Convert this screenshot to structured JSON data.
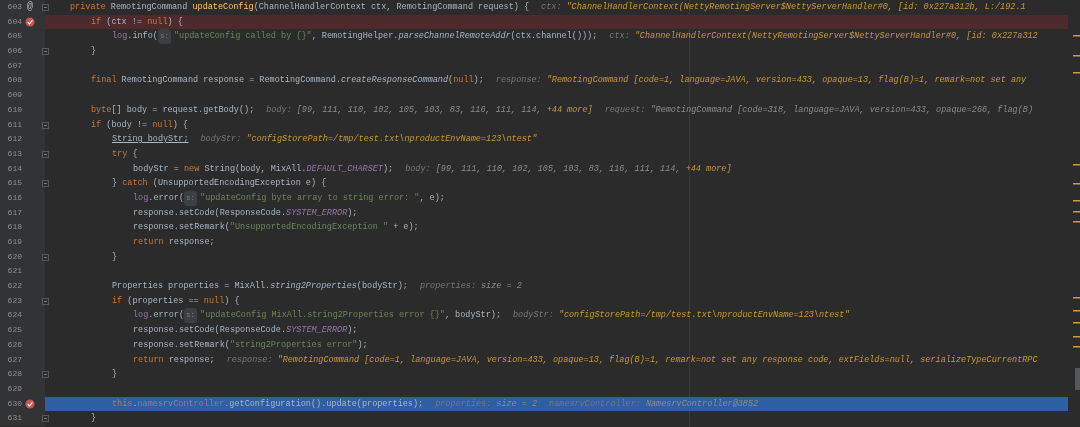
{
  "lines": [
    {
      "number": "603",
      "gutter_mark": "@",
      "breakpoint": false,
      "current": false,
      "fold": true,
      "tokens": [
        {
          "kind": "keyword",
          "text": "private "
        },
        {
          "kind": "plain",
          "text": "RemotingCommand "
        },
        {
          "kind": "method",
          "text": "updateConfig"
        },
        {
          "kind": "plain",
          "text": "(ChannelHandlerContext ctx, RemotingCommand request) {"
        },
        {
          "kind": "hint-name",
          "text": "ctx:"
        },
        {
          "kind": "hint-string",
          "text": "\"ChannelHandlerContext(NettyRemotingServer$NettyServerHandler#0, [id: 0x227a312b, L:/192.1"
        }
      ],
      "children": [
        {
          "number": "604",
          "breakpoint": true,
          "current": false,
          "fold": false,
          "tokens": [
            {
              "kind": "keyword",
              "text": "if"
            },
            {
              "kind": "plain",
              "text": " (ctx != "
            },
            {
              "kind": "keyword",
              "text": "null"
            },
            {
              "kind": "plain",
              "text": ") {"
            }
          ],
          "children": [
            {
              "number": "605",
              "breakpoint": false,
              "current": false,
              "fold": false,
              "tokens": [
                {
                  "kind": "field",
                  "text": "log"
                },
                {
                  "kind": "plain",
                  "text": ".info("
                },
                {
                  "kind": "param",
                  "text": "s:"
                },
                {
                  "kind": "string",
                  "text": "\"updateConfig called by {}\""
                },
                {
                  "kind": "plain",
                  "text": ", RemotingHelper."
                },
                {
                  "kind": "static",
                  "text": "parseChannelRemoteAddr"
                },
                {
                  "kind": "plain",
                  "text": "(ctx.channel()));"
                },
                {
                  "kind": "hint-name",
                  "text": "ctx:"
                },
                {
                  "kind": "hint-string",
                  "text": "\"ChannelHandlerContext(NettyRemotingServer$NettyServerHandler#0, [id: 0x227a312"
                }
              ]
            }
          ]
        },
        {
          "number": "606",
          "breakpoint": false,
          "current": false,
          "fold": true,
          "tokens": [
            {
              "kind": "plain",
              "text": "}"
            }
          ]
        },
        {
          "number": "607",
          "breakpoint": false,
          "current": false,
          "fold": false
        },
        {
          "number": "608",
          "breakpoint": false,
          "current": false,
          "fold": false,
          "tokens": [
            {
              "kind": "keyword",
              "text": "final "
            },
            {
              "kind": "plain",
              "text": "RemotingCommand response = RemotingCommand."
            },
            {
              "kind": "static",
              "text": "createResponseCommand"
            },
            {
              "kind": "plain",
              "text": "("
            },
            {
              "kind": "keyword",
              "text": "null"
            },
            {
              "kind": "plain",
              "text": ");"
            },
            {
              "kind": "hint-name",
              "text": "response:"
            },
            {
              "kind": "hint-string",
              "text": "\"RemotingCommand [code=1, language=JAVA, version=433, opaque=13, flag(B)=1, remark=not set any"
            }
          ]
        },
        {
          "number": "609",
          "breakpoint": false,
          "current": false,
          "fold": false
        },
        {
          "number": "610",
          "breakpoint": false,
          "current": false,
          "fold": false,
          "tokens": [
            {
              "kind": "keyword",
              "text": "byte"
            },
            {
              "kind": "plain",
              "text": "[] body = request.getBody();"
            },
            {
              "kind": "hint-name",
              "text": "body:"
            },
            {
              "kind": "hint-value",
              "text": "[99, 111, 110, 102, 105, 103, 83, 116, 111, 114, "
            },
            {
              "kind": "hint-string",
              "text": "+44 more]"
            },
            {
              "kind": "hint-name",
              "text": "request:"
            },
            {
              "kind": "hint-value",
              "text": "\"RemotingCommand [code=318, language=JAVA, version=433, opaque=266, flag(B)"
            }
          ]
        },
        {
          "number": "611",
          "breakpoint": false,
          "current": false,
          "fold": true,
          "tokens": [
            {
              "kind": "keyword",
              "text": "if"
            },
            {
              "kind": "plain",
              "text": " (body != "
            },
            {
              "kind": "keyword",
              "text": "null"
            },
            {
              "kind": "plain",
              "text": ") {"
            }
          ],
          "children": [
            {
              "number": "612",
              "breakpoint": false,
              "current": false,
              "fold": false,
              "tokens": [
                {
                  "kind": "underlined",
                  "text": "String bodyStr;"
                },
                {
                  "kind": "hint-name",
                  "text": "bodyStr:"
                },
                {
                  "kind": "hint-string",
                  "text": "\"configStorePath=/tmp/test.txt\\nproductEnvName=123\\ntest\""
                }
              ]
            },
            {
              "number": "613",
              "breakpoint": false,
              "current": false,
              "fold": true,
              "tokens": [
                {
                  "kind": "keyword",
                  "text": "try"
                },
                {
                  "kind": "plain",
                  "text": " {"
                }
              ],
              "children": [
                {
                  "number": "614",
                  "breakpoint": false,
                  "current": false,
                  "fold": false,
                  "tokens": [
                    {
                      "kind": "plain",
                      "text": "bodyStr = "
                    },
                    {
                      "kind": "keyword",
                      "text": "new "
                    },
                    {
                      "kind": "plain",
                      "text": "String(body, MixAll."
                    },
                    {
                      "kind": "constant",
                      "text": "DEFAULT_CHARSET"
                    },
                    {
                      "kind": "plain",
                      "text": ");"
                    },
                    {
                      "kind": "hint-name",
                      "text": "body:"
                    },
                    {
                      "kind": "hint-value",
                      "text": "[99, 111, 110, 102, 105, 103, 83, 116, 111, 114, "
                    },
                    {
                      "kind": "hint-string",
                      "text": "+44 more]"
                    }
                  ]
                }
              ]
            },
            {
              "number": "615",
              "breakpoint": false,
              "current": false,
              "fold": true,
              "tokens": [
                {
                  "kind": "plain",
                  "text": "} "
                },
                {
                  "kind": "keyword",
                  "text": "catch"
                },
                {
                  "kind": "plain",
                  "text": " (UnsupportedEncodingException e) {"
                }
              ],
              "children": [
                {
                  "number": "616",
                  "breakpoint": false,
                  "current": false,
                  "fold": false,
                  "tokens": [
                    {
                      "kind": "field",
                      "text": "log"
                    },
                    {
                      "kind": "plain",
                      "text": ".error("
                    },
                    {
                      "kind": "param",
                      "text": "s:"
                    },
                    {
                      "kind": "string",
                      "text": "\"updateConfig byte array to string error: \""
                    },
                    {
                      "kind": "plain",
                      "text": ", e);"
                    }
                  ]
                },
                {
                  "number": "617",
                  "breakpoint": false,
                  "current": false,
                  "fold": false,
                  "tokens": [
                    {
                      "kind": "plain",
                      "text": "response.setCode(ResponseCode."
                    },
                    {
                      "kind": "constant",
                      "text": "SYSTEM_ERROR"
                    },
                    {
                      "kind": "plain",
                      "text": ");"
                    }
                  ]
                },
                {
                  "number": "618",
                  "breakpoint": false,
                  "current": false,
                  "fold": false,
                  "tokens": [
                    {
                      "kind": "plain",
                      "text": "response.setRemark("
                    },
                    {
                      "kind": "string",
                      "text": "\"UnsupportedEncodingException \""
                    },
                    {
                      "kind": "plain",
                      "text": " + e);"
                    }
                  ]
                },
                {
                  "number": "619",
                  "breakpoint": false,
                  "current": false,
                  "fold": false,
                  "tokens": [
                    {
                      "kind": "keyword",
                      "text": "return"
                    },
                    {
                      "kind": "plain",
                      "text": " response;"
                    }
                  ]
                }
              ]
            },
            {
              "number": "620",
              "breakpoint": false,
              "current": false,
              "fold": true,
              "tokens": [
                {
                  "kind": "plain",
                  "text": "}"
                }
              ]
            },
            {
              "number": "621",
              "breakpoint": false,
              "current": false,
              "fold": false
            },
            {
              "number": "622",
              "breakpoint": false,
              "current": false,
              "fold": false,
              "tokens": [
                {
                  "kind": "plain",
                  "text": "Properties properties = MixAll."
                },
                {
                  "kind": "static",
                  "text": "string2Properties"
                },
                {
                  "kind": "plain",
                  "text": "(bodyStr);"
                },
                {
                  "kind": "hint-name",
                  "text": "properties:"
                },
                {
                  "kind": "hint-value",
                  "text": "size = 2"
                }
              ]
            },
            {
              "number": "623",
              "breakpoint": false,
              "current": false,
              "fold": true,
              "tokens": [
                {
                  "kind": "keyword",
                  "text": "if"
                },
                {
                  "kind": "plain",
                  "text": " (properties == "
                },
                {
                  "kind": "keyword",
                  "text": "null"
                },
                {
                  "kind": "plain",
                  "text": ") {"
                }
              ],
              "children": [
                {
                  "number": "624",
                  "breakpoint": false,
                  "current": false,
                  "fold": false,
                  "tokens": [
                    {
                      "kind": "field",
                      "text": "log"
                    },
                    {
                      "kind": "plain",
                      "text": ".error("
                    },
                    {
                      "kind": "param",
                      "text": "s:"
                    },
                    {
                      "kind": "string",
                      "text": "\"updateConfig MixAll.string2Properties error {}\""
                    },
                    {
                      "kind": "plain",
                      "text": ", bodyStr);"
                    },
                    {
                      "kind": "hint-name",
                      "text": "bodyStr:"
                    },
                    {
                      "kind": "hint-string",
                      "text": "\"configStorePath=/tmp/test.txt\\nproductEnvName=123\\ntest\""
                    }
                  ]
                },
                {
                  "number": "625",
                  "breakpoint": false,
                  "current": false,
                  "fold": false,
                  "tokens": [
                    {
                      "kind": "plain",
                      "text": "response.setCode(ResponseCode."
                    },
                    {
                      "kind": "constant",
                      "text": "SYSTEM_ERROR"
                    },
                    {
                      "kind": "plain",
                      "text": ");"
                    }
                  ]
                },
                {
                  "number": "626",
                  "breakpoint": false,
                  "current": false,
                  "fold": false,
                  "tokens": [
                    {
                      "kind": "plain",
                      "text": "response.setRemark("
                    },
                    {
                      "kind": "string",
                      "text": "\"string2Properties error\""
                    },
                    {
                      "kind": "plain",
                      "text": ");"
                    }
                  ]
                },
                {
                  "number": "627",
                  "breakpoint": false,
                  "current": false,
                  "fold": false,
                  "tokens": [
                    {
                      "kind": "keyword",
                      "text": "return"
                    },
                    {
                      "kind": "plain",
                      "text": " response;"
                    },
                    {
                      "kind": "hint-name",
                      "text": "response:"
                    },
                    {
                      "kind": "hint-string",
                      "text": "\"RemotingCommand [code=1, language=JAVA, version=433, opaque=13, flag(B)=1, remark=not set any response code, extFields=null, serializeTypeCurrentRPC"
                    }
                  ]
                }
              ]
            },
            {
              "number": "628",
              "breakpoint": false,
              "current": false,
              "fold": true,
              "tokens": [
                {
                  "kind": "plain",
                  "text": "}"
                }
              ]
            },
            {
              "number": "629",
              "breakpoint": false,
              "current": false,
              "fold": false
            },
            {
              "number": "630",
              "breakpoint": true,
              "current": true,
              "fold": false,
              "tokens": [
                {
                  "kind": "keyword",
                  "text": "this"
                },
                {
                  "kind": "plain",
                  "text": "."
                },
                {
                  "kind": "field",
                  "text": "namesrvController"
                },
                {
                  "kind": "plain",
                  "text": ".getConfiguration().update(properties);"
                },
                {
                  "kind": "hint-name",
                  "text": "properties:"
                },
                {
                  "kind": "hint-value",
                  "text": "size = 2"
                },
                {
                  "kind": "hint-name",
                  "text": "namesrvController:"
                },
                {
                  "kind": "hint-value",
                  "text": "NamesrvController@3852"
                }
              ]
            }
          ]
        },
        {
          "number": "631",
          "breakpoint": false,
          "current": false,
          "fold": true,
          "tokens": [
            {
              "kind": "plain",
              "text": "}"
            }
          ]
        }
      ]
    }
  ]
}
